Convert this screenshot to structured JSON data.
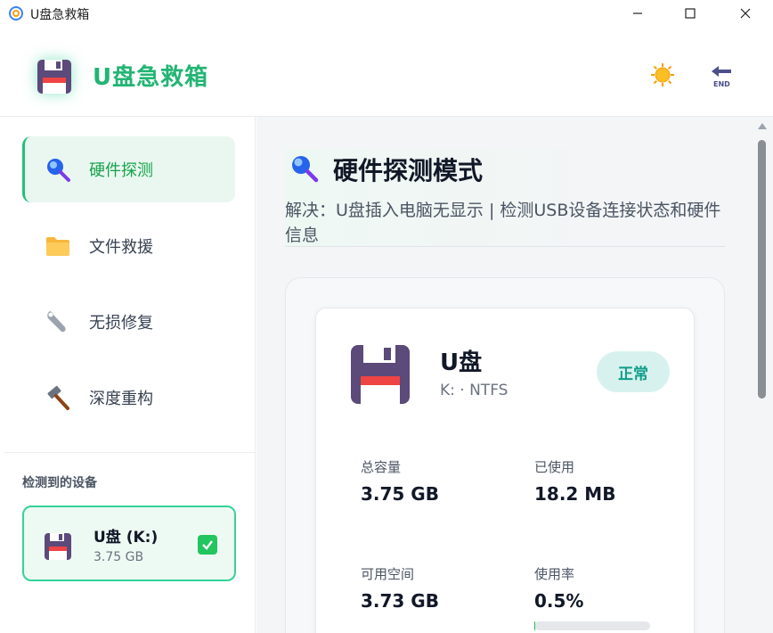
{
  "window": {
    "title": "U盘急救箱",
    "controls": [
      "minimize-icon",
      "maximize-icon",
      "close-icon"
    ]
  },
  "header": {
    "brand": "U盘急救箱",
    "logo_icon": "floppy-disk-icon",
    "theme_icon": "sun-icon",
    "exit_icon": "end-arrow-icon",
    "brand_color": "#22b573"
  },
  "sidebar": {
    "items": [
      {
        "label": "硬件探测",
        "icon": "magnifier-icon",
        "active": true
      },
      {
        "label": "文件救援",
        "icon": "folder-icon",
        "active": false
      },
      {
        "label": "无损修复",
        "icon": "wrench-icon",
        "active": false
      },
      {
        "label": "深度重构",
        "icon": "hammer-icon",
        "active": false
      }
    ],
    "devices_title": "检测到的设备",
    "device": {
      "name": "U盘 (K:)",
      "size": "3.75 GB",
      "selected": true
    }
  },
  "main": {
    "title": "硬件探测模式",
    "subtitle": "解决：U盘插入电脑无显示 | 检测USB设备连接状态和硬件信息",
    "device_card": {
      "name": "U盘",
      "filesystem": "K: · NTFS",
      "status": "正常",
      "stats": [
        {
          "label": "总容量",
          "value": "3.75 GB"
        },
        {
          "label": "已使用",
          "value": "18.2 MB"
        },
        {
          "label": "可用空间",
          "value": "3.73 GB"
        },
        {
          "label": "使用率",
          "value": "0.5%"
        }
      ],
      "usage_fraction": 0.005
    }
  },
  "colors": {
    "accent": "#22c55e",
    "status_bg": "#d7f2ee",
    "status_text": "#0f9d8a"
  }
}
